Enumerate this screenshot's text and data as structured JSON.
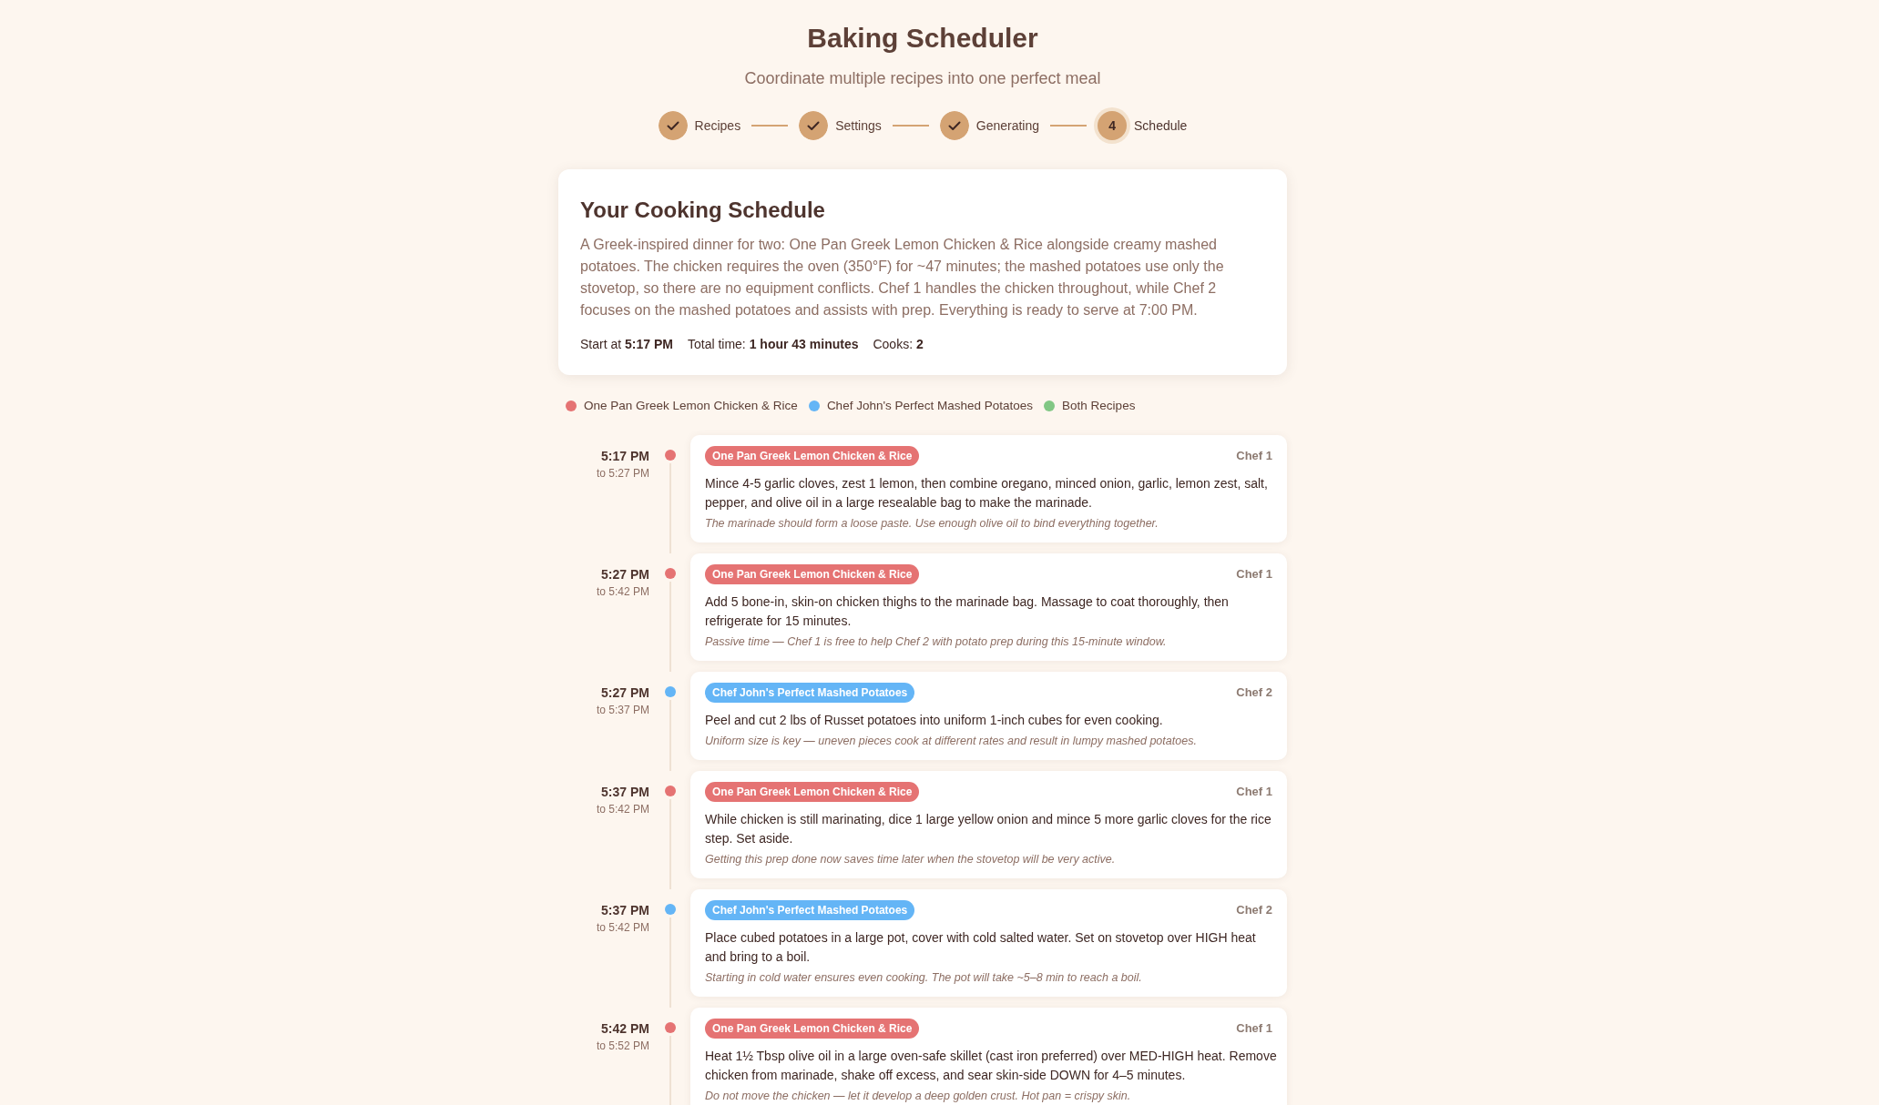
{
  "header": {
    "title": "Baking Scheduler",
    "subtitle": "Coordinate multiple recipes into one perfect meal"
  },
  "steps": [
    {
      "label": "Recipes",
      "completed": true,
      "selected": false
    },
    {
      "label": "Settings",
      "completed": true,
      "selected": false
    },
    {
      "label": "Generating",
      "completed": true,
      "selected": false
    },
    {
      "label": "Schedule",
      "number": "4",
      "completed": false,
      "selected": true
    }
  ],
  "summary": {
    "title": "Your Cooking Schedule",
    "description": "A Greek-inspired dinner for two: One Pan Greek Lemon Chicken & Rice alongside creamy mashed potatoes. The chicken requires the oven (350°F) for ~47 minutes; the mashed potatoes use only the stovetop, so there are no equipment conflicts. Chef 1 handles the chicken throughout, while Chef 2 focuses on the mashed potatoes and assists with prep. Everything is ready to serve at 7:00 PM.",
    "stats": [
      "Start at **5:17 PM**",
      "Total time: **1 hour 43 minutes**",
      "Cooks: **2**"
    ]
  },
  "legend": [
    {
      "label": "One Pan Greek Lemon Chicken & Rice",
      "color": "#e57373"
    },
    {
      "label": "Chef John's Perfect Mashed Potatoes",
      "color": "#64b5f6"
    },
    {
      "label": "Both Recipes",
      "color": "#81c784"
    }
  ],
  "timeline": [
    {
      "start": "5:17 PM",
      "end": "to 5:27 PM",
      "recipe": "One Pan Greek Lemon Chicken & Rice",
      "color": "#e57373",
      "cook": "Chef 1",
      "instruction": "Mince 4-5 garlic cloves, zest 1 lemon, then combine oregano, minced onion, garlic, lemon zest, salt, pepper, and olive oil in a large resealable bag to make the marinade.",
      "note": "The marinade should form a loose paste. Use enough olive oil to bind everything together."
    },
    {
      "start": "5:27 PM",
      "end": "to 5:42 PM",
      "recipe": "One Pan Greek Lemon Chicken & Rice",
      "color": "#e57373",
      "cook": "Chef 1",
      "instruction": "Add 5 bone-in, skin-on chicken thighs to the marinade bag. Massage to coat thoroughly, then refrigerate for 15 minutes.",
      "note": "Passive time — Chef 1 is free to help Chef 2 with potato prep during this 15-minute window."
    },
    {
      "start": "5:27 PM",
      "end": "to 5:37 PM",
      "recipe": "Chef John's Perfect Mashed Potatoes",
      "color": "#64b5f6",
      "cook": "Chef 2",
      "instruction": "Peel and cut 2 lbs of Russet potatoes into uniform 1-inch cubes for even cooking.",
      "note": "Uniform size is key — uneven pieces cook at different rates and result in lumpy mashed potatoes."
    },
    {
      "start": "5:37 PM",
      "end": "to 5:42 PM",
      "recipe": "One Pan Greek Lemon Chicken & Rice",
      "color": "#e57373",
      "cook": "Chef 1",
      "instruction": "While chicken is still marinating, dice 1 large yellow onion and mince 5 more garlic cloves for the rice step. Set aside.",
      "note": "Getting this prep done now saves time later when the stovetop will be very active."
    },
    {
      "start": "5:37 PM",
      "end": "to 5:42 PM",
      "recipe": "Chef John's Perfect Mashed Potatoes",
      "color": "#64b5f6",
      "cook": "Chef 2",
      "instruction": "Place cubed potatoes in a large pot, cover with cold salted water. Set on stovetop over HIGH heat and bring to a boil.",
      "note": "Starting in cold water ensures even cooking. The pot will take ~5–8 min to reach a boil."
    },
    {
      "start": "5:42 PM",
      "end": "to 5:52 PM",
      "recipe": "One Pan Greek Lemon Chicken & Rice",
      "color": "#e57373",
      "cook": "Chef 1",
      "instruction": "Heat 1½ Tbsp olive oil in a large oven-safe skillet (cast iron preferred) over MED-HIGH heat. Remove chicken from marinade, shake off excess, and sear skin-side DOWN for 4–5 minutes.",
      "note": "Do not move the chicken — let it develop a deep golden crust. Hot pan = crispy skin."
    }
  ]
}
